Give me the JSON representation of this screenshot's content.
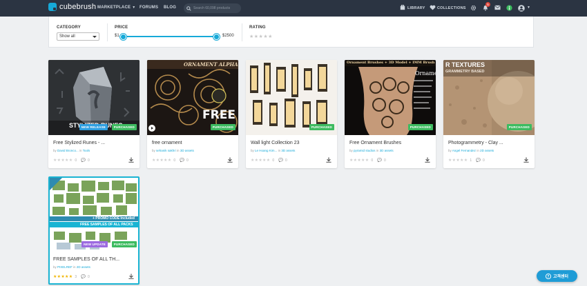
{
  "header": {
    "logo": "cubebrush",
    "nav": {
      "marketplace": "MARKETPLACE",
      "forums": "FORUMS",
      "blog": "BLOG"
    },
    "search_placeholder": "Search 60,098 products",
    "library": "LIBRARY",
    "collections": "COLLECTIONS",
    "notification_count": "5"
  },
  "filters": {
    "category_label": "CATEGORY",
    "category_value": "Show all",
    "price_label": "PRICE",
    "price_min": "$1",
    "price_max": "$2500",
    "rating_label": "RATING",
    "rating_stars": "★★★★★"
  },
  "cards": [
    {
      "title": "Free Stylized Runes - ...",
      "by": "by",
      "author": "David Bronco...",
      "in": "in",
      "category": "Tools",
      "badges": [
        "NEW RELEASE",
        "PURCHASED"
      ],
      "overlay": "STYLIZED RUNES",
      "stars": "★★★★★",
      "rating_count": "0",
      "comment_count": "0"
    },
    {
      "title": "free ornament",
      "by": "by",
      "author": "sehanik sakhri",
      "in": "in",
      "category": "3D assets",
      "badges": [
        "PURCHASED"
      ],
      "overlay": "ORNAMENT ALPHA",
      "overlay2": "FREE",
      "stars": "★★★★★",
      "rating_count": "0",
      "comment_count": "0"
    },
    {
      "title": "Wall light Collection 23",
      "by": "by",
      "author": "Le Hoang Kim...",
      "in": "in",
      "category": "3D assets",
      "badges": [
        "PURCHASED"
      ],
      "stars": "★★★★★",
      "rating_count": "0",
      "comment_count": "0"
    },
    {
      "title": "Free Ornament Brushes",
      "by": "by",
      "author": "pyramid studios",
      "in": "in",
      "category": "3D assets",
      "badges": [
        "PURCHASED"
      ],
      "overlay": "Ornament Brushes + 3D Model + IMM Brush",
      "stars": "★★★★★",
      "rating_count": "0",
      "comment_count": "0"
    },
    {
      "title": "Photogrammetry - Clay ...",
      "by": "by",
      "author": "Angel Fernandez",
      "in": "in",
      "category": "2D assets",
      "badges": [
        "PURCHASED"
      ],
      "overlay": "R TEXTURES",
      "overlay2": "GRAMMETRY BASED",
      "stars": "★★★★★",
      "rating_count": "1",
      "comment_count": "0"
    },
    {
      "title": "FREE SAMPLES OF ALL TH...",
      "by": "by",
      "author": "PIXELREF",
      "in": "in",
      "category": "2D assets",
      "badges": [
        "NEW UPDATE",
        "PURCHASED"
      ],
      "overlay": "+ PROMO CODE Included",
      "overlay2": "FREE SAMPLES OF ALL PACKS",
      "stars": "★★★★★",
      "rating_count": "3",
      "comment_count": "0"
    }
  ],
  "chat": {
    "label": "고객센터"
  },
  "colors": {
    "accent": "#16a9d8",
    "topbar": "#2b3442",
    "purchased": "#3dbb60",
    "star_gold": "#f0b400"
  }
}
